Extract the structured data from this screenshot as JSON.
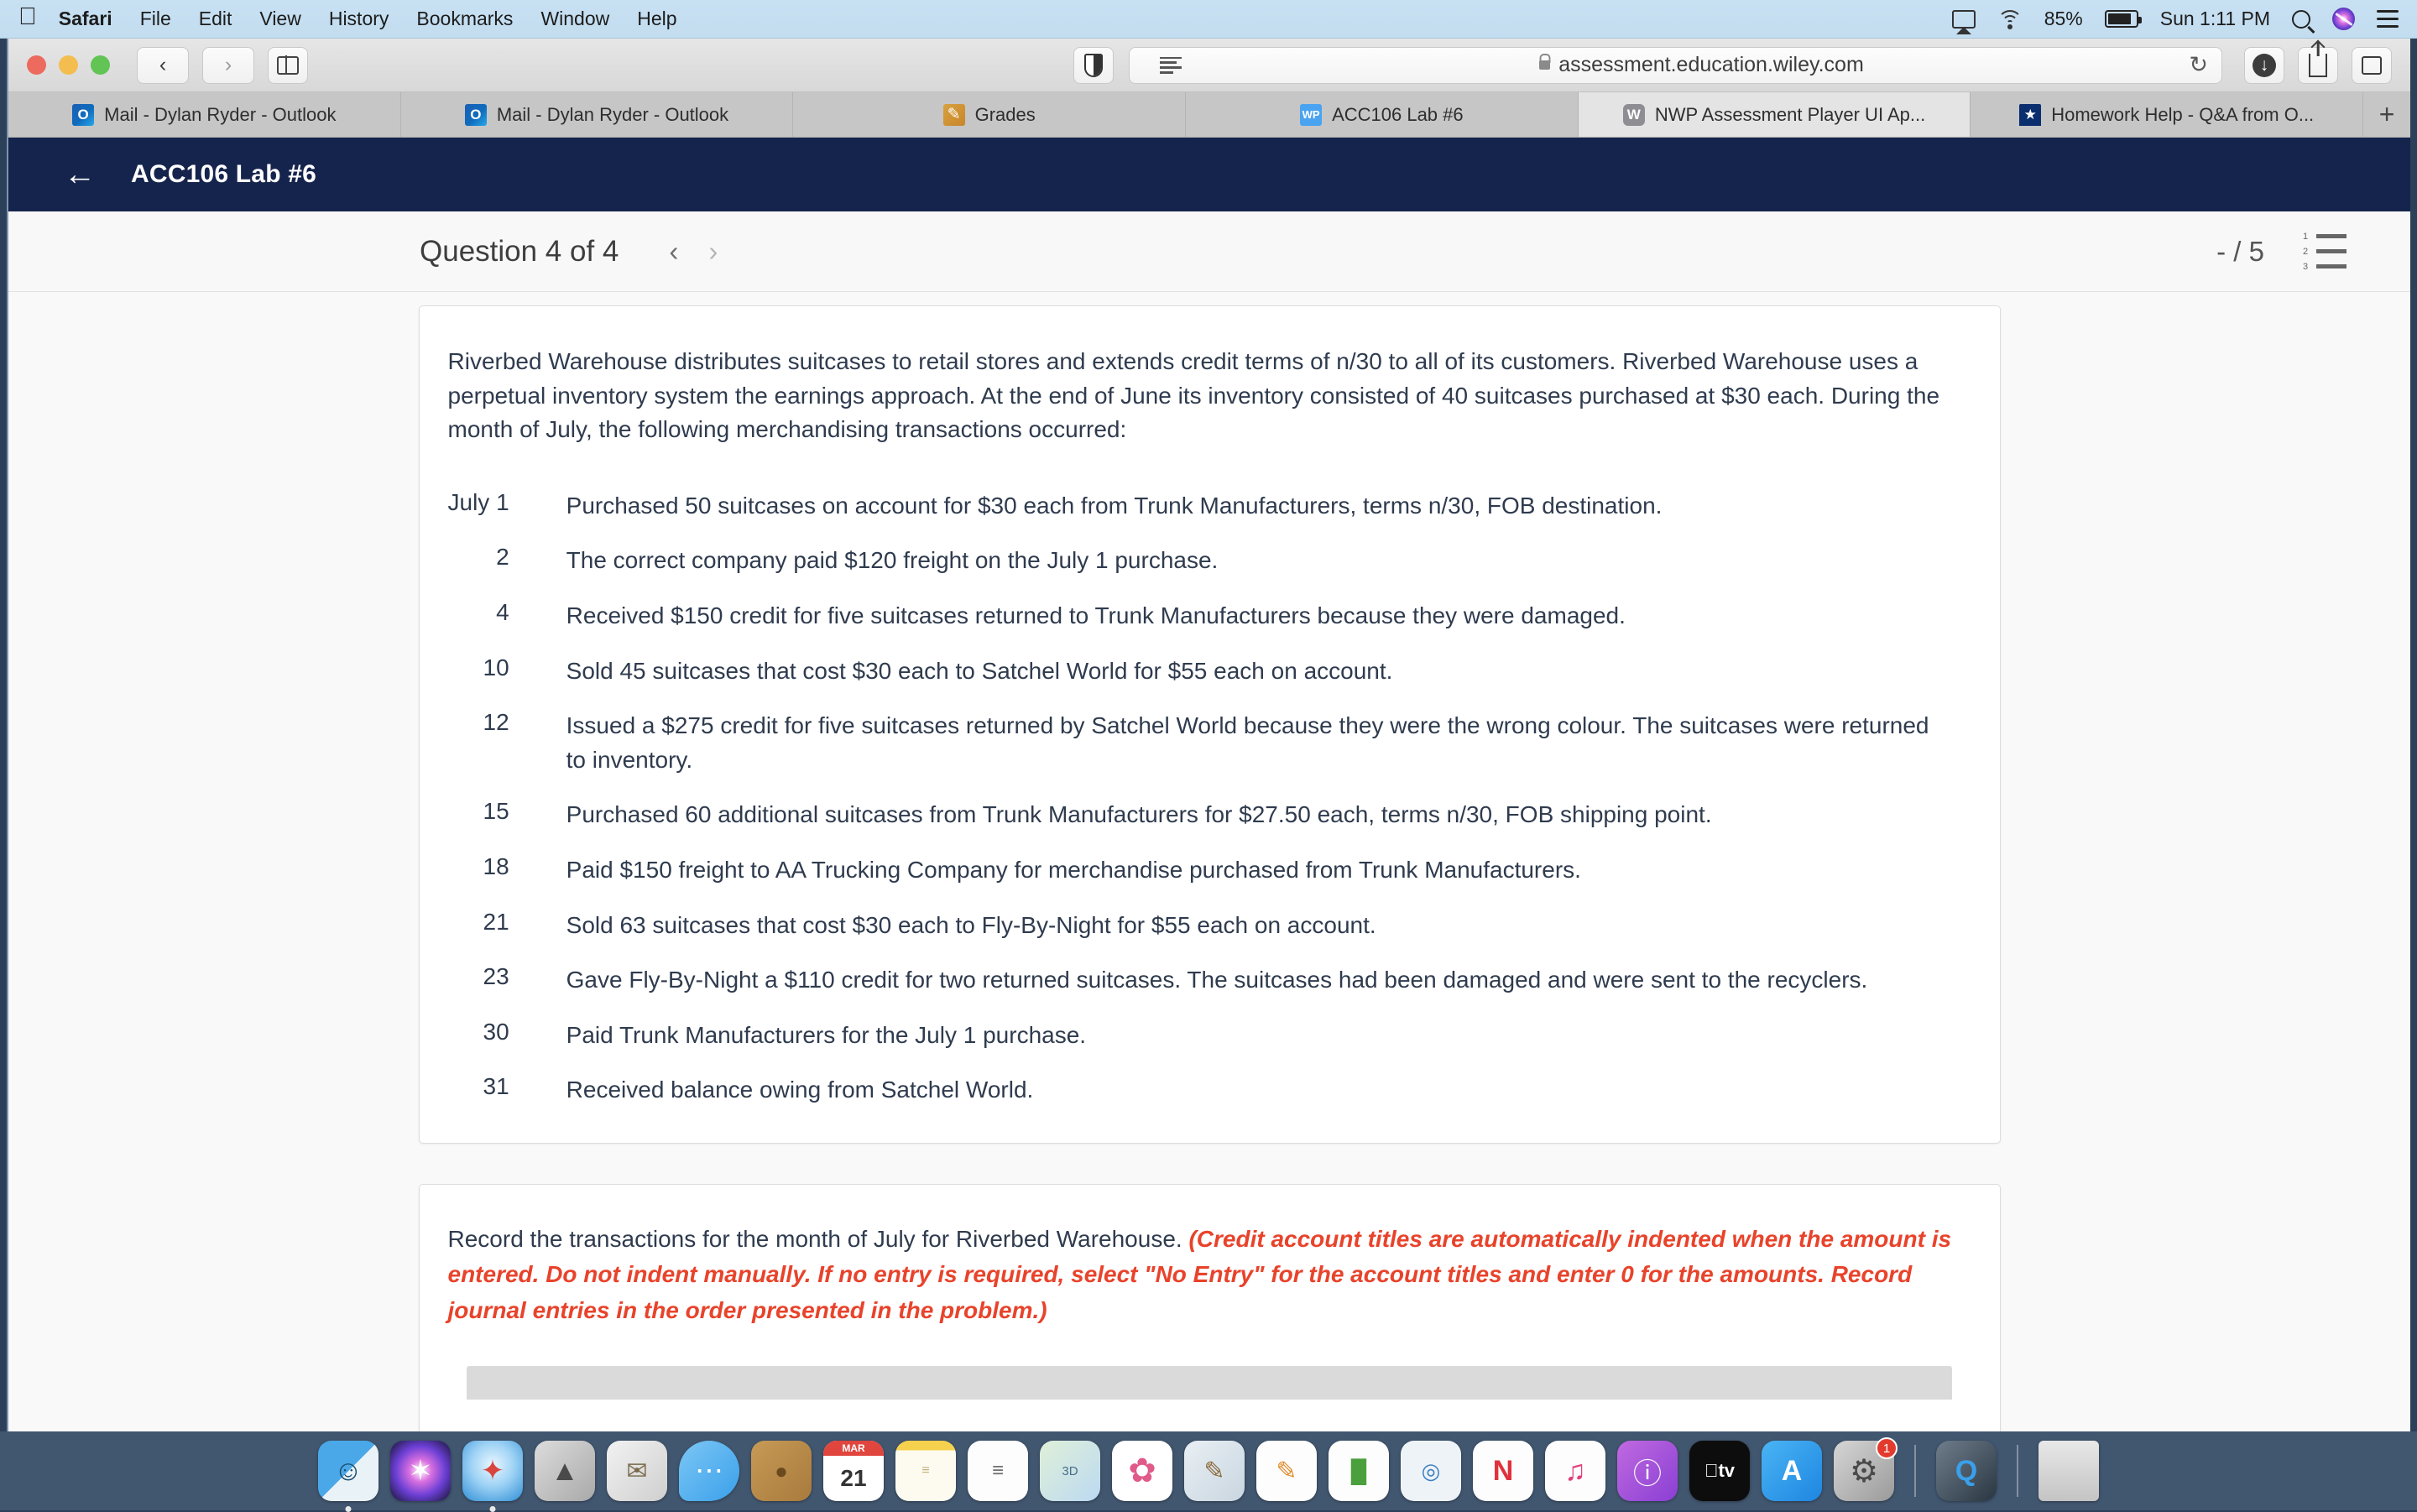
{
  "menubar": {
    "apple_glyph": "",
    "items": [
      {
        "label": "Safari",
        "bold": true
      },
      {
        "label": "File",
        "bold": false
      },
      {
        "label": "Edit",
        "bold": false
      },
      {
        "label": "View",
        "bold": false
      },
      {
        "label": "History",
        "bold": false
      },
      {
        "label": "Bookmarks",
        "bold": false
      },
      {
        "label": "Window",
        "bold": false
      },
      {
        "label": "Help",
        "bold": false
      }
    ],
    "status": {
      "airplay_icon": "airplay-icon",
      "wifi_icon": "wifi-icon",
      "battery_percent": "85%",
      "battery_icon": "battery-icon",
      "clock": "Sun 1:11 PM",
      "search_icon": "spotlight-search-icon",
      "siri_icon": "siri-icon",
      "control_center_icon": "control-center-icon"
    }
  },
  "browser": {
    "toolbar": {
      "back_glyph": "‹",
      "forward_glyph": "›",
      "sidebar_icon": "sidebar-toggle-icon",
      "shield_icon": "privacy-report-icon",
      "reader_icon": "reader-view-icon",
      "url": "assessment.education.wiley.com",
      "lock_icon": "lock-icon",
      "reload_glyph": "↻",
      "downloads_icon": "downloads-icon",
      "share_icon": "share-icon",
      "tab_overview_icon": "tab-overview-icon"
    },
    "tabs": [
      {
        "label": "Mail - Dylan Ryder - Outlook",
        "favicon": "outlook-favicon",
        "active": false
      },
      {
        "label": "Mail - Dylan Ryder - Outlook",
        "favicon": "outlook-favicon",
        "active": false
      },
      {
        "label": "Grades",
        "favicon": "grades-favicon",
        "active": false
      },
      {
        "label": "ACC106 Lab #6",
        "favicon": "wileyplus-favicon",
        "active": false
      },
      {
        "label": "NWP Assessment Player UI Ap...",
        "favicon": "wiley-favicon",
        "active": true
      },
      {
        "label": "Homework Help - Q&A from O...",
        "favicon": "coursehero-favicon",
        "active": false
      }
    ],
    "new_tab_glyph": "+"
  },
  "app": {
    "header": {
      "back_glyph": "←",
      "title": "ACC106 Lab #6"
    },
    "question_bar": {
      "title": "Question 4 of 4",
      "prev_glyph": "‹",
      "next_glyph": "›",
      "score": "- / 5",
      "list_icon": "numbered-list-icon",
      "list_numbers": [
        "1",
        "2",
        "3"
      ]
    },
    "question_card": {
      "intro": "Riverbed Warehouse distributes suitcases to retail stores and extends credit terms of n/30 to all of its customers. Riverbed Warehouse uses a perpetual inventory system the earnings approach. At the end of June its inventory consisted of 40 suitcases purchased at $30 each. During the month of July, the following merchandising transactions occurred:",
      "transactions": [
        {
          "date": "July 1",
          "text": "Purchased 50 suitcases on account for $30 each from Trunk Manufacturers, terms n/30, FOB destination."
        },
        {
          "date": "2",
          "text": "The correct company paid $120 freight on the July 1 purchase."
        },
        {
          "date": "4",
          "text": "Received $150 credit for five suitcases returned to Trunk Manufacturers because they were damaged."
        },
        {
          "date": "10",
          "text": "Sold 45 suitcases that cost $30 each to Satchel World for $55 each on account."
        },
        {
          "date": "12",
          "text": "Issued a $275 credit for five suitcases returned by Satchel World because they were the wrong colour. The suitcases were returned to inventory."
        },
        {
          "date": "15",
          "text": "Purchased 60 additional suitcases from Trunk Manufacturers for $27.50 each, terms n/30, FOB shipping point."
        },
        {
          "date": "18",
          "text": "Paid $150 freight to AA Trucking Company for merchandise purchased from Trunk Manufacturers."
        },
        {
          "date": "21",
          "text": "Sold 63 suitcases that cost $30 each to Fly-By-Night for $55 each on account."
        },
        {
          "date": "23",
          "text": "Gave Fly-By-Night a $110 credit for two returned suitcases. The suitcases had been damaged and were sent to the recyclers."
        },
        {
          "date": "30",
          "text": "Paid Trunk Manufacturers for the July 1 purchase."
        },
        {
          "date": "31",
          "text": "Received balance owing from Satchel World."
        }
      ]
    },
    "instruction_card": {
      "black_text": "Record the transactions for the month of July for Riverbed Warehouse. ",
      "red_text": "(Credit account titles are automatically indented when the amount is entered. Do not indent manually. If no entry is required, select \"No Entry\" for the account titles and enter 0 for the amounts. Record journal entries in the order presented in the problem.)",
      "red_color": "#e8432b"
    }
  },
  "dock": {
    "apps": [
      {
        "name": "finder",
        "glyph": "☺",
        "bg": "linear-gradient(135deg,#4aa8e8 0%,#4aa8e8 50%,#e9f2f7 50%,#e9f2f7 100%)",
        "color": "#1b4f72",
        "running": true
      },
      {
        "name": "siri",
        "glyph": "✦",
        "bg": "radial-gradient(circle at 50% 50%,#ffffff 0%,#d96fe0 26%,#6b3fd4 58%,#14142e 100%)",
        "color": "#ffffff",
        "running": false
      },
      {
        "name": "safari",
        "glyph": "✦",
        "bg": "radial-gradient(circle at 50% 40%,#eaf6ff 0%,#9fd3f5 45%,#2f8fd6 100%)",
        "color": "#d9453d",
        "running": true
      },
      {
        "name": "launchpad",
        "glyph": "▲",
        "bg": "linear-gradient(135deg,#dcdcdc,#a9a9a9)",
        "color": "#4a4a4a",
        "running": false
      },
      {
        "name": "mail",
        "glyph": "✉",
        "bg": "linear-gradient(135deg,#f2f2f2,#cfcfcf)",
        "color": "#7a6a4a",
        "running": false
      },
      {
        "name": "messages",
        "glyph": "⋯",
        "bg": "linear-gradient(135deg,#7cc7f5,#3aa0ea)",
        "color": "#ffffff",
        "running": false
      },
      {
        "name": "contacts",
        "glyph": "●",
        "bg": "linear-gradient(135deg,#c79a57,#a87a3c)",
        "color": "#6b4a1e",
        "running": false
      },
      {
        "name": "calendar",
        "glyph": "21",
        "bg": "#ffffff",
        "color": "#333333",
        "running": false
      },
      {
        "name": "notes",
        "glyph": "",
        "bg": "linear-gradient(to bottom,#f5d14e 0%,#f5d14e 16%,#fdfbf0 16%,#fdfbf0 100%)",
        "color": "#a89a60",
        "running": false
      },
      {
        "name": "reminders",
        "glyph": "≡",
        "bg": "#fdfdfd",
        "color": "#6f6f6f",
        "running": false
      },
      {
        "name": "maps",
        "glyph": "3D",
        "bg": "linear-gradient(135deg,#dff0d8,#bcd9f2)",
        "color": "#4a6f8a",
        "running": false
      },
      {
        "name": "photos",
        "glyph": "✿",
        "bg": "#ffffff",
        "color": "#e05a8a",
        "running": false
      },
      {
        "name": "preview",
        "glyph": "✎",
        "bg": "linear-gradient(135deg,#e9eff4,#c9d6e0)",
        "color": "#8a6a3a",
        "running": false
      },
      {
        "name": "pages",
        "glyph": "✎",
        "bg": "#fdfdfd",
        "color": "#e08a2a",
        "running": false
      },
      {
        "name": "numbers",
        "glyph": "█",
        "bg": "#fdfdfd",
        "color": "#4aa03c",
        "running": false
      },
      {
        "name": "keynote",
        "glyph": "◎",
        "bg": "#eef3f8",
        "color": "#3a7fc1",
        "running": false
      },
      {
        "name": "news",
        "glyph": "N",
        "bg": "#fdfdfd",
        "color": "#e0323c",
        "running": false
      },
      {
        "name": "itunes",
        "glyph": "♫",
        "bg": "#fdfdfd",
        "color": "#e0407a",
        "running": false
      },
      {
        "name": "podcasts",
        "glyph": "ⓘ",
        "bg": "linear-gradient(135deg,#c06ae0,#8a3fd4)",
        "color": "#ffffff",
        "running": false
      },
      {
        "name": "apple-tv",
        "glyph": "tv",
        "bg": "#0d0d0d",
        "color": "#ffffff",
        "running": false
      },
      {
        "name": "app-store",
        "glyph": "A",
        "bg": "linear-gradient(135deg,#4ab4f5,#1e86e0)",
        "color": "#ffffff",
        "running": false
      },
      {
        "name": "system-preferences",
        "glyph": "⚙",
        "bg": "linear-gradient(135deg,#d6d6d6,#9a9a9a)",
        "color": "#4a4a4a",
        "running": false,
        "badge": "1"
      },
      {
        "name": "quicktime",
        "glyph": "Q",
        "bg": "linear-gradient(135deg,#6f7d8c,#2a3742)",
        "color": "#3aa0ea",
        "running": false
      },
      {
        "name": "trash",
        "glyph": "",
        "bg": "linear-gradient(to bottom,#e8e8e8,#c4c4c4)",
        "color": "#777777",
        "running": false
      }
    ]
  }
}
